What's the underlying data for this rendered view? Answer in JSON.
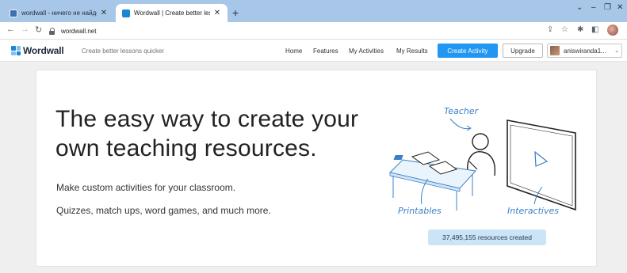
{
  "browser": {
    "tabs": [
      {
        "title": "wordwall - ничего не найдено. Wordwall",
        "active": false
      },
      {
        "title": "Wordwall | Create better lessons quicker",
        "active": true
      }
    ],
    "new_tab_icon": "plus-icon",
    "address": "wordwall.net"
  },
  "site": {
    "logo_text": "Wordwall",
    "tagline": "Create better lessons quicker",
    "nav": {
      "home": "Home",
      "features": "Features",
      "my_activities": "My Activities",
      "my_results": "My Results"
    },
    "create_activity": "Create Activity",
    "upgrade": "Upgrade",
    "username": "aniswiranda1..."
  },
  "hero": {
    "headline": "The easy way to create your own teaching resources.",
    "line1": "Make custom activities for your classroom.",
    "line2": "Quizzes, match ups, word games, and much more.",
    "labels": {
      "teacher": "Teacher",
      "printables": "Printables",
      "interactives": "Interactives"
    },
    "resources_count": "37,495,155 resources created"
  },
  "colors": {
    "accent": "#2196f3",
    "tab_strip": "#a8c7e8",
    "counter_bg": "#cbe4f6",
    "illustration": "#3b80c7"
  }
}
